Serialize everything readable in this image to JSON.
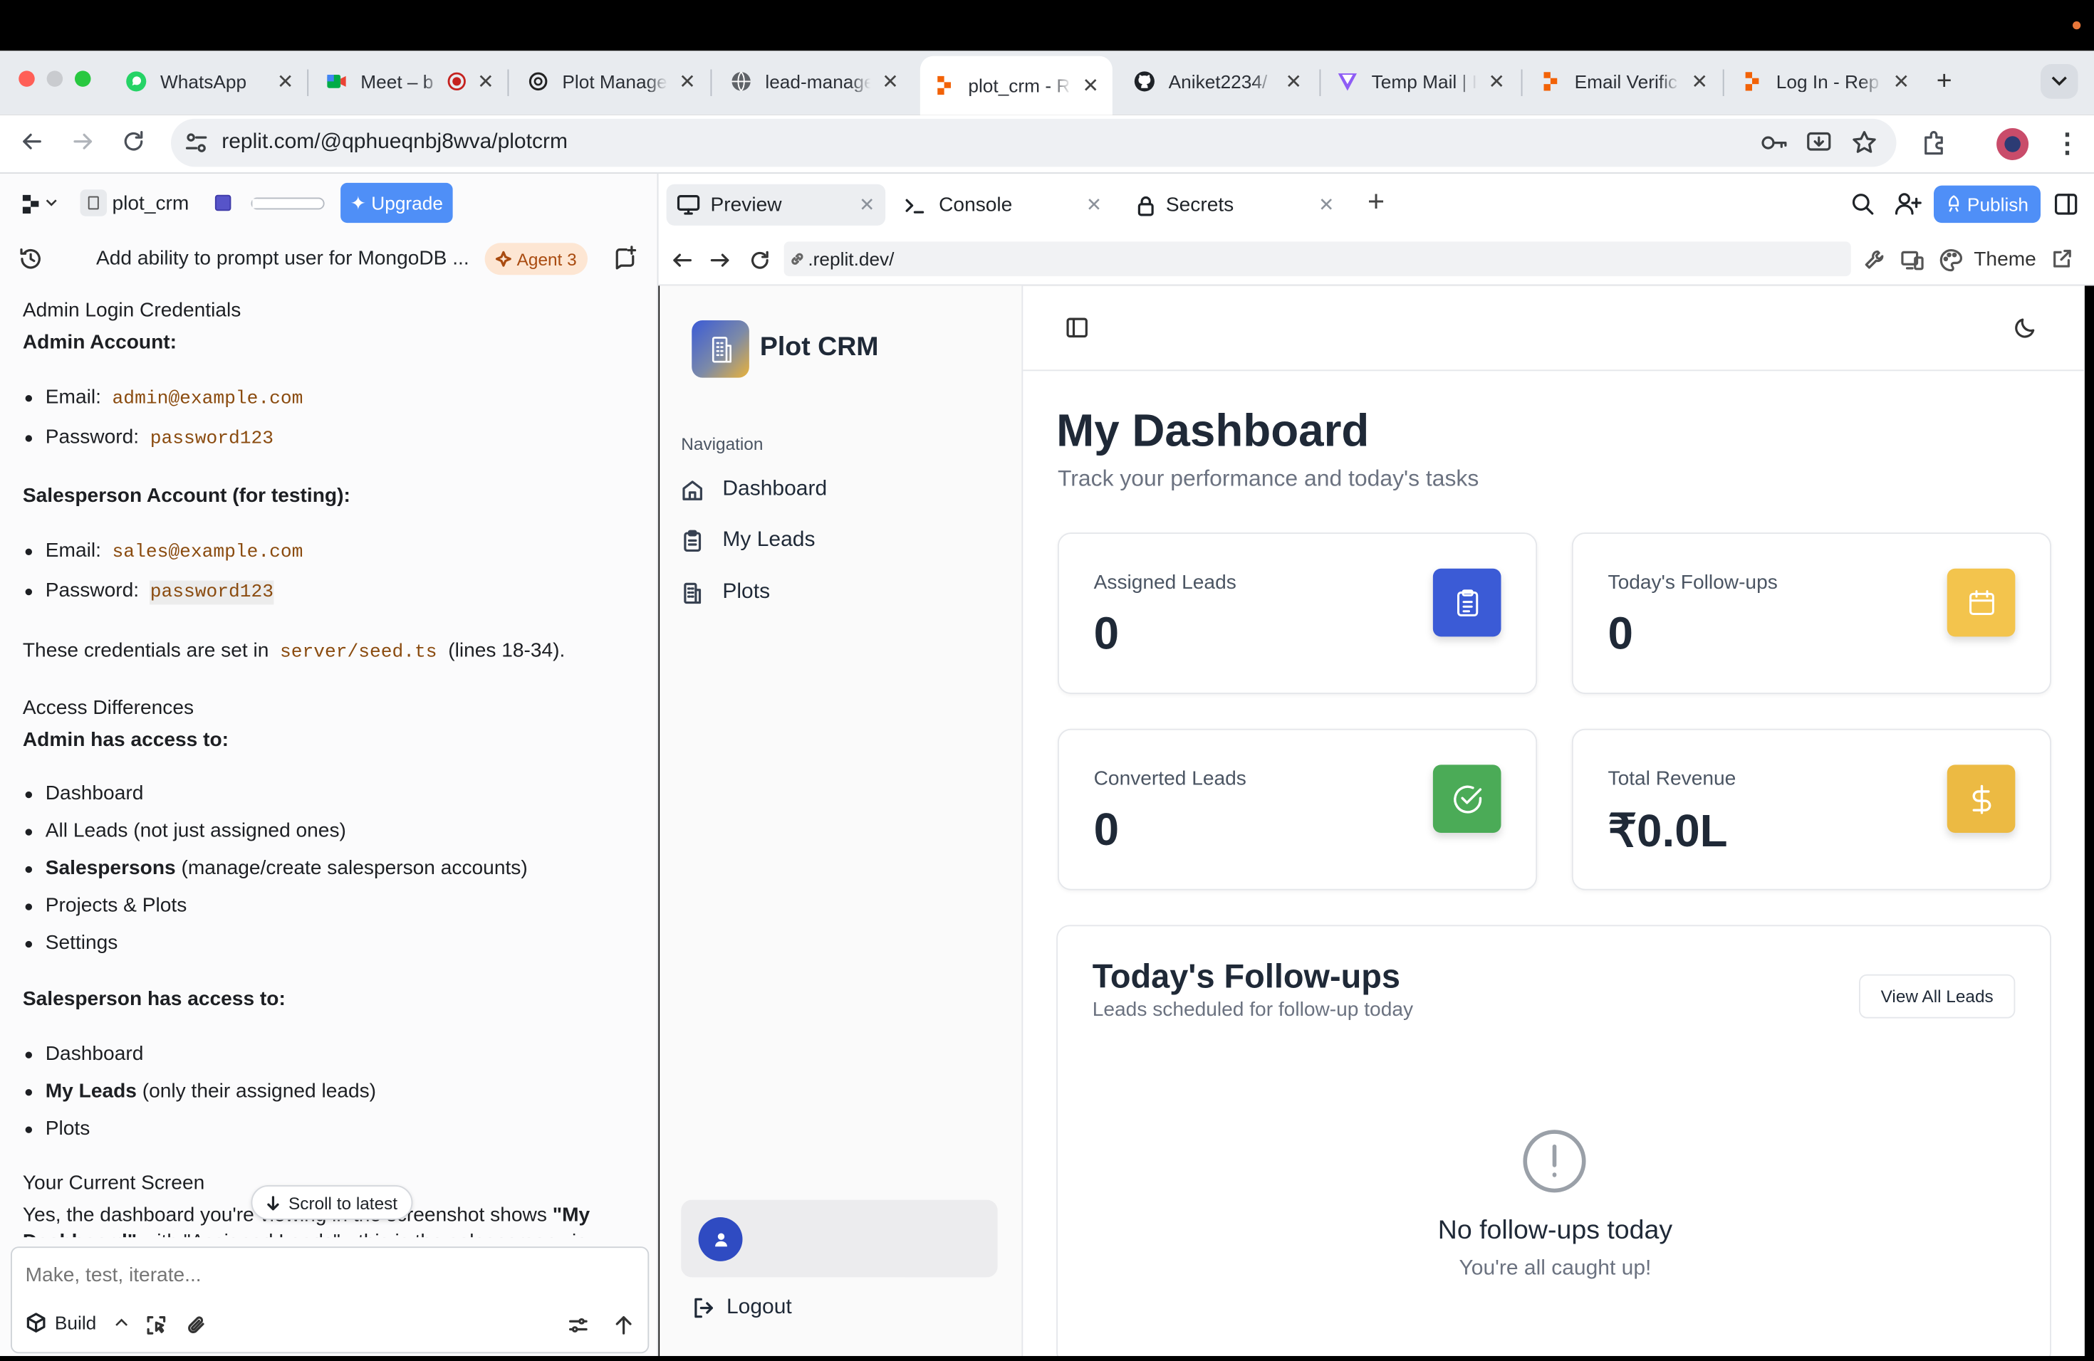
{
  "browser": {
    "tabs": [
      {
        "title": "WhatsApp",
        "icon": "whatsapp-icon"
      },
      {
        "title": "Meet – b",
        "icon": "google-meet-icon"
      },
      {
        "title": "Plot Manage",
        "icon": "openai-icon"
      },
      {
        "title": "lead-manage",
        "icon": "globe-icon"
      },
      {
        "title": "plot_crm - R",
        "icon": "replit-icon"
      },
      {
        "title": "Aniket2234/",
        "icon": "github-icon"
      },
      {
        "title": "Temp Mail | I",
        "icon": "tempmail-icon"
      },
      {
        "title": "Email Verific",
        "icon": "replit-icon"
      },
      {
        "title": "Log In - Rep",
        "icon": "replit-icon"
      }
    ],
    "active_tab": 4,
    "url": "replit.com/@qphueqnbj8wva/plotcrm"
  },
  "workspace": {
    "project_name": "plot_crm",
    "upgrade_label": "Upgrade",
    "agent_title": "Add ability to prompt user for MongoDB ...",
    "agent_badge": "Agent 3",
    "input_placeholder": "Make, test, iterate...",
    "build_label": "Build",
    "scroll_label": "Scroll to latest"
  },
  "chat": {
    "h_creds": "Admin Login Credentials",
    "admin_account": "Admin Account:",
    "email_label": "Email:",
    "password_label": "Password:",
    "admin_email": "admin@example.com",
    "admin_password": "password123",
    "sales_account": "Salesperson Account (for testing):",
    "sales_email": "sales@example.com",
    "sales_password": "password123",
    "creds_note_pre": "These credentials are set in",
    "creds_file": "server/seed.ts",
    "creds_note_post": "(lines 18-34).",
    "h_access": "Access Differences",
    "admin_access": "Admin has access to:",
    "admin_items": {
      "i1": "Dashboard",
      "i2": "All Leads (not just assigned ones)",
      "i3_bold": "Salespersons",
      "i3_rest": "(manage/create salesperson accounts)",
      "i4": "Projects & Plots",
      "i5": "Settings"
    },
    "sales_access": "Salesperson has access to:",
    "sales_items": {
      "i1": "Dashboard",
      "i2_bold": "My Leads",
      "i2_rest": "(only their assigned leads)",
      "i3": "Plots"
    },
    "h_screen": "Your Current Screen",
    "screen_text_pre": "Yes, the dashboard you're viewing in the screenshot shows",
    "screen_text_bold": "\"My Dashboard\"",
    "screen_text_rest": "with \"Assigned Leads\" - this is the salesperson view"
  },
  "panel": {
    "tabs": [
      "Preview",
      "Console",
      "Secrets"
    ],
    "publish_label": "Publish",
    "preview_url": ".replit.dev/",
    "theme_label": "Theme"
  },
  "app": {
    "brand": "Plot CRM",
    "nav_label": "Navigation",
    "nav": [
      "Dashboard",
      "My Leads",
      "Plots"
    ],
    "logout": "Logout",
    "title": "My Dashboard",
    "subtitle": "Track your performance and today's tasks",
    "cards": [
      {
        "label": "Assigned Leads",
        "value": "0",
        "color": "#3b5bd6"
      },
      {
        "label": "Today's Follow-ups",
        "value": "0",
        "color": "#f3c44d"
      },
      {
        "label": "Converted Leads",
        "value": "0",
        "color": "#4bab57"
      },
      {
        "label": "Total Revenue",
        "value": "₹0.0L",
        "color": "#ecba43"
      }
    ],
    "followups": {
      "title": "Today's Follow-ups",
      "subtitle": "Leads scheduled for follow-up today",
      "view_all": "View All Leads",
      "empty_title": "No follow-ups today",
      "empty_sub": "You're all caught up!"
    }
  }
}
